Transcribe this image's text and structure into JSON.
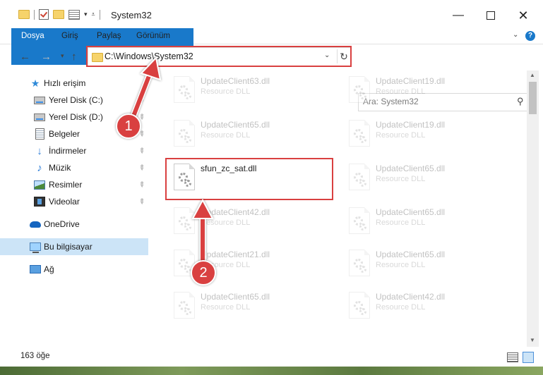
{
  "window": {
    "title": "System32",
    "controls": {
      "minimize": "—",
      "close": "✕"
    }
  },
  "ribbon": {
    "tabs": [
      "Dosya",
      "Giriş",
      "Paylaş",
      "Görünüm"
    ],
    "accent": "#1979ca",
    "help": "?"
  },
  "address": {
    "path": "C:\\Windows\\System32",
    "search_placeholder": "Ara: System32"
  },
  "nav_pane": {
    "items": [
      {
        "label": "Hızlı erişim",
        "icon": "star-icon"
      },
      {
        "label": "Yerel Disk (C:)",
        "icon": "drive-icon"
      },
      {
        "label": "Yerel Disk (D:)",
        "icon": "drive-icon"
      },
      {
        "label": "Belgeler",
        "icon": "documents-icon"
      },
      {
        "label": "İndirmeler",
        "icon": "download-icon"
      },
      {
        "label": "Müzik",
        "icon": "music-icon"
      },
      {
        "label": "Resimler",
        "icon": "pictures-icon"
      },
      {
        "label": "Videolar",
        "icon": "videos-icon"
      },
      {
        "label": "OneDrive",
        "icon": "onedrive-icon"
      },
      {
        "label": "Bu bilgisayar",
        "icon": "computer-icon"
      },
      {
        "label": "Ağ",
        "icon": "network-icon"
      }
    ]
  },
  "files": {
    "left": [
      {
        "name": "UpdateClient63.dll",
        "type": "Resource DLL"
      },
      {
        "name": "UpdateClient65.dll",
        "type": "Resource DLL"
      },
      {
        "name": "sfun_zc_sat.dll",
        "type": ""
      },
      {
        "name": "UpdateClient42.dll",
        "type": "Resource DLL"
      },
      {
        "name": "UpdateClient21.dll",
        "type": "Resource DLL"
      },
      {
        "name": "UpdateClient65.dll",
        "type": "Resource DLL"
      }
    ],
    "right": [
      {
        "name": "UpdateClient19.dll",
        "type": "Resource DLL"
      },
      {
        "name": "UpdateClient19.dll",
        "type": "Resource DLL"
      },
      {
        "name": "UpdateClient65.dll",
        "type": "Resource DLL"
      },
      {
        "name": "UpdateClient65.dll",
        "type": "Resource DLL"
      },
      {
        "name": "UpdateClient65.dll",
        "type": "Resource DLL"
      },
      {
        "name": "UpdateClient42.dll",
        "type": "Resource DLL"
      }
    ]
  },
  "annotations": {
    "step1": "1",
    "step2": "2",
    "color": "#d94040"
  },
  "status": {
    "item_count": "163 öğe"
  }
}
